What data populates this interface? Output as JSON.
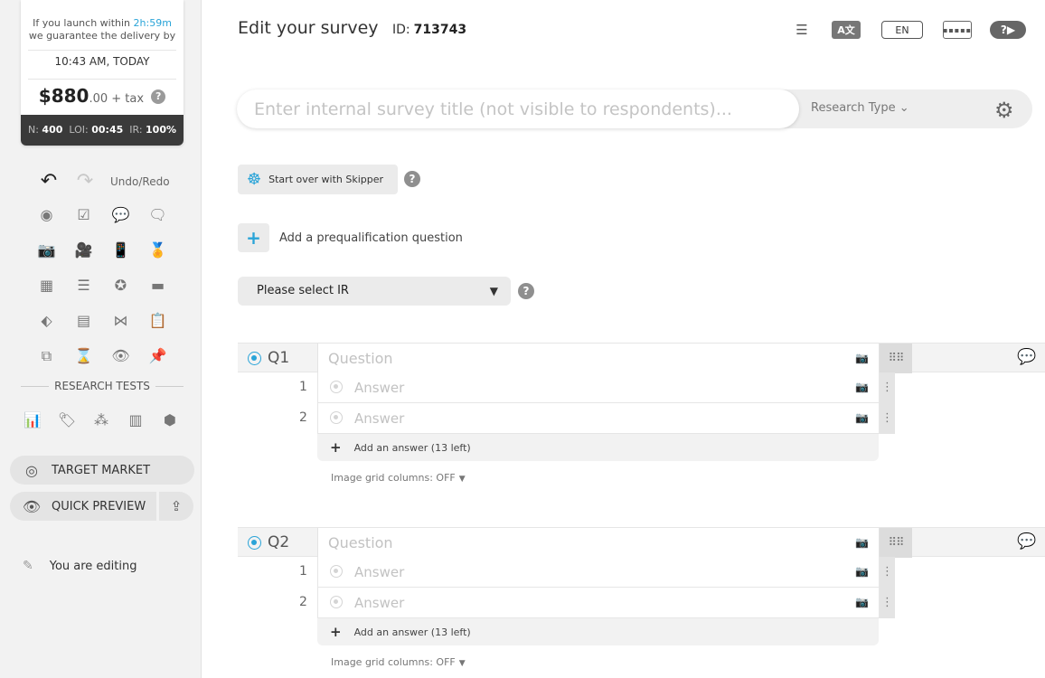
{
  "sidebar": {
    "delivery_prefix": "If you launch within",
    "delivery_countdown": "2h:59m",
    "delivery_suffix": "we guarantee the delivery by",
    "delivery_time": "10:43 AM, TODAY",
    "price_main": "$880",
    "price_cents": ".00",
    "price_tax": "+ tax",
    "stats": {
      "n_label": "N:",
      "n_value": "400",
      "loi_label": "LOI:",
      "loi_value": "00:45",
      "ir_label": "IR:",
      "ir_value": "100%"
    },
    "undo_redo_label": "Undo/Redo",
    "tools": [
      {
        "name": "single-choice-icon",
        "glyph": "◉"
      },
      {
        "name": "multiple-choice-icon",
        "glyph": "☑"
      },
      {
        "name": "open-ended-icon",
        "glyph": "💬"
      },
      {
        "name": "text-feedback-icon",
        "glyph": "🗨"
      },
      {
        "name": "image-question-icon",
        "glyph": "📷"
      },
      {
        "name": "video-question-icon",
        "glyph": "🎥"
      },
      {
        "name": "mobile-test-icon",
        "glyph": "📱"
      },
      {
        "name": "award-icon",
        "glyph": "🏅"
      },
      {
        "name": "matrix-grid-icon",
        "glyph": "▦"
      },
      {
        "name": "slider-icon",
        "glyph": "☰"
      },
      {
        "name": "star-rating-icon",
        "glyph": "✪"
      },
      {
        "name": "card-icon",
        "glyph": "▬"
      },
      {
        "name": "ranking-icon",
        "glyph": "⬖"
      },
      {
        "name": "list-icon",
        "glyph": "▤"
      },
      {
        "name": "maxdiff-icon",
        "glyph": "⋈"
      },
      {
        "name": "clipboard-icon",
        "glyph": "📋"
      },
      {
        "name": "dual-icon",
        "glyph": "⧉"
      },
      {
        "name": "timer-icon",
        "glyph": "⌛"
      },
      {
        "name": "eye-track-icon",
        "glyph": "👁"
      },
      {
        "name": "pin-icon",
        "glyph": "📌"
      }
    ],
    "research_tests_label": "RESEARCH TESTS",
    "research_tests": [
      {
        "name": "bar-chart-test-icon",
        "glyph": "📊"
      },
      {
        "name": "price-tag-test-icon",
        "glyph": "🏷"
      },
      {
        "name": "concept-test-icon",
        "glyph": "⁂"
      },
      {
        "name": "shelf-test-icon",
        "glyph": "▥"
      },
      {
        "name": "package-test-icon",
        "glyph": "⬢"
      }
    ],
    "target_market_label": "TARGET MARKET",
    "quick_preview_label": "QUICK PREVIEW",
    "you_are_editing": "You are editing"
  },
  "header": {
    "title": "Edit your survey",
    "id_label": "ID:",
    "id_value": "713743",
    "lang_label": "EN",
    "translate_label": "A文"
  },
  "title_input": {
    "placeholder": "Enter internal survey title (not visible to respondents)...",
    "research_type_label": "Research Type"
  },
  "skipper_label": "Start over with Skipper",
  "prequal_label": "Add a prequalification question",
  "ir_select_label": "Please select IR",
  "questions": [
    {
      "label": "Q1",
      "placeholder": "Question",
      "answers": [
        {
          "num": "1",
          "placeholder": "Answer"
        },
        {
          "num": "2",
          "placeholder": "Answer"
        }
      ],
      "add_answer_label": "Add an answer (13 left)",
      "grid_columns_label": "Image grid columns: OFF"
    },
    {
      "label": "Q2",
      "placeholder": "Question",
      "answers": [
        {
          "num": "1",
          "placeholder": "Answer"
        },
        {
          "num": "2",
          "placeholder": "Answer"
        }
      ],
      "add_answer_label": "Add an answer (13 left)",
      "grid_columns_label": "Image grid columns: OFF"
    }
  ]
}
